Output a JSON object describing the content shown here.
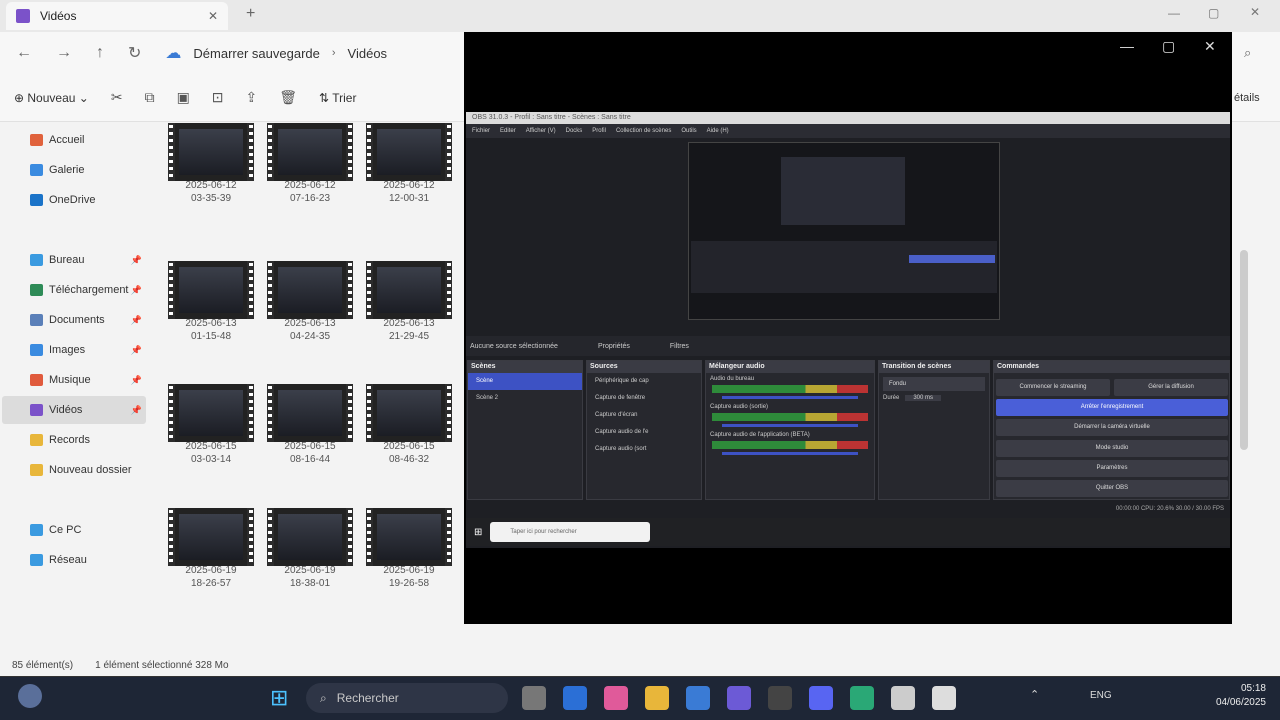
{
  "explorer": {
    "tab_title": "Vidéos",
    "breadcrumb": [
      "Démarrer sauvegarde",
      "Vidéos"
    ],
    "toolbar": {
      "new_label": "Nouveau",
      "sort_label": "Trier",
      "details_label": "étails"
    },
    "sidebar": [
      {
        "label": "Accueil",
        "color": "#e0623c"
      },
      {
        "label": "Galerie",
        "color": "#3a8be0"
      },
      {
        "label": "OneDrive",
        "color": "#1a73c8"
      },
      {
        "label": "Bureau",
        "color": "#3a9ae0"
      },
      {
        "label": "Téléchargement",
        "color": "#2e8b57"
      },
      {
        "label": "Documents",
        "color": "#5a7fb8"
      },
      {
        "label": "Images",
        "color": "#3a8be0"
      },
      {
        "label": "Musique",
        "color": "#e05a3c"
      },
      {
        "label": "Vidéos",
        "color": "#7b52c9"
      },
      {
        "label": "Records",
        "color": "#e8b63a"
      },
      {
        "label": "Nouveau dossier",
        "color": "#e8b63a"
      },
      {
        "label": "Ce PC",
        "color": "#3a9ae0"
      },
      {
        "label": "Réseau",
        "color": "#3a9ae0"
      }
    ],
    "files": [
      {
        "d": "2025-06-12",
        "t": "03-35-39"
      },
      {
        "d": "2025-06-12",
        "t": "07-16-23"
      },
      {
        "d": "2025-06-12",
        "t": "12-00-31"
      },
      {
        "d": "2025-06-13",
        "t": "01-15-48"
      },
      {
        "d": "2025-06-13",
        "t": "04-24-35"
      },
      {
        "d": "2025-06-13",
        "t": "21-29-45"
      },
      {
        "d": "2025-06-15",
        "t": "03-03-14"
      },
      {
        "d": "2025-06-15",
        "t": "08-16-44"
      },
      {
        "d": "2025-06-15",
        "t": "08-46-32"
      },
      {
        "d": "2025-06-19",
        "t": "18-26-57"
      },
      {
        "d": "2025-06-19",
        "t": "18-38-01"
      },
      {
        "d": "2025-06-19",
        "t": "19-26-58"
      }
    ],
    "status": {
      "count": "85 élément(s)",
      "selected": "1 élément sélectionné 328 Mo"
    }
  },
  "obs": {
    "title": "OBS 31.0.3 - Profil : Sans titre - Scènes : Sans titre",
    "menu": [
      "Fichier",
      "Editer",
      "Afficher (V)",
      "Docks",
      "Profil",
      "Collection de scènes",
      "Outils",
      "Aide (H)"
    ],
    "no_source": "Aucune source sélectionnée",
    "properties": "Propriétés",
    "filters": "Filtres",
    "docks": {
      "scenes": "Scènes",
      "sources": "Sources",
      "mixer": "Mélangeur audio",
      "transitions": "Transition de scènes",
      "controls": "Commandes"
    },
    "scenes": [
      "Scène",
      "Scène 2"
    ],
    "sources": [
      "Périphérique de cap",
      "Capture de fenêtre",
      "Capture d'écran",
      "Capture audio de l'e",
      "Capture audio (sort"
    ],
    "mixer": [
      "Audio du bureau",
      "Capture audio (sortie)",
      "Capture audio de l'application (BETA)"
    ],
    "transition": {
      "type": "Fondu",
      "duration_label": "Durée",
      "duration": "300 ms"
    },
    "controls": {
      "start_stream": "Commencer le streaming",
      "manage_broadcast": "Gérer la diffusion",
      "stop_record": "Arrêter l'enregistrement",
      "virtual_cam": "Démarrer la caméra virtuelle",
      "studio": "Mode studio",
      "settings": "Paramètres",
      "quit": "Quitter OBS"
    },
    "status_text": "00:00:00   CPU: 20.6%   30.00 / 30.00 FPS",
    "inner_search": "Taper ici pour rechercher"
  },
  "taskbar": {
    "search": "Rechercher",
    "lang": "ENG",
    "time": "05:18",
    "date": "04/06/2025"
  }
}
